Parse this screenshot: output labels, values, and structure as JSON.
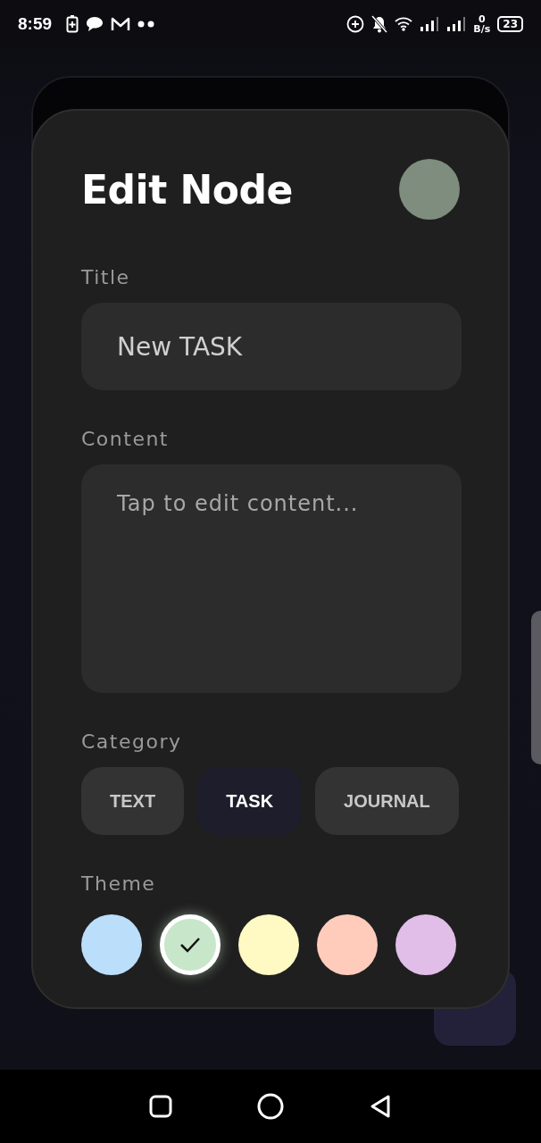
{
  "status_bar": {
    "time": "8:59",
    "net_speed_value": "0",
    "net_speed_unit": "B/s",
    "battery": "23"
  },
  "dialog": {
    "title": "Edit Node",
    "preview": {
      "color": "#7e8d7d"
    },
    "title_field": {
      "label": "Title",
      "value": "New TASK"
    },
    "content_field": {
      "label": "Content",
      "placeholder": "Tap to edit content..."
    },
    "category": {
      "label": "Category",
      "options": [
        {
          "label": "TEXT",
          "selected": false
        },
        {
          "label": "TASK",
          "selected": true
        },
        {
          "label": "JOURNAL",
          "selected": false
        }
      ]
    },
    "theme": {
      "label": "Theme",
      "swatches": [
        {
          "color": "#bbdefb",
          "selected": false
        },
        {
          "color": "#c8e6c9",
          "selected": true
        },
        {
          "color": "#fff9c4",
          "selected": false
        },
        {
          "color": "#ffccbc",
          "selected": false
        },
        {
          "color": "#e1bee7",
          "selected": false
        }
      ]
    }
  }
}
